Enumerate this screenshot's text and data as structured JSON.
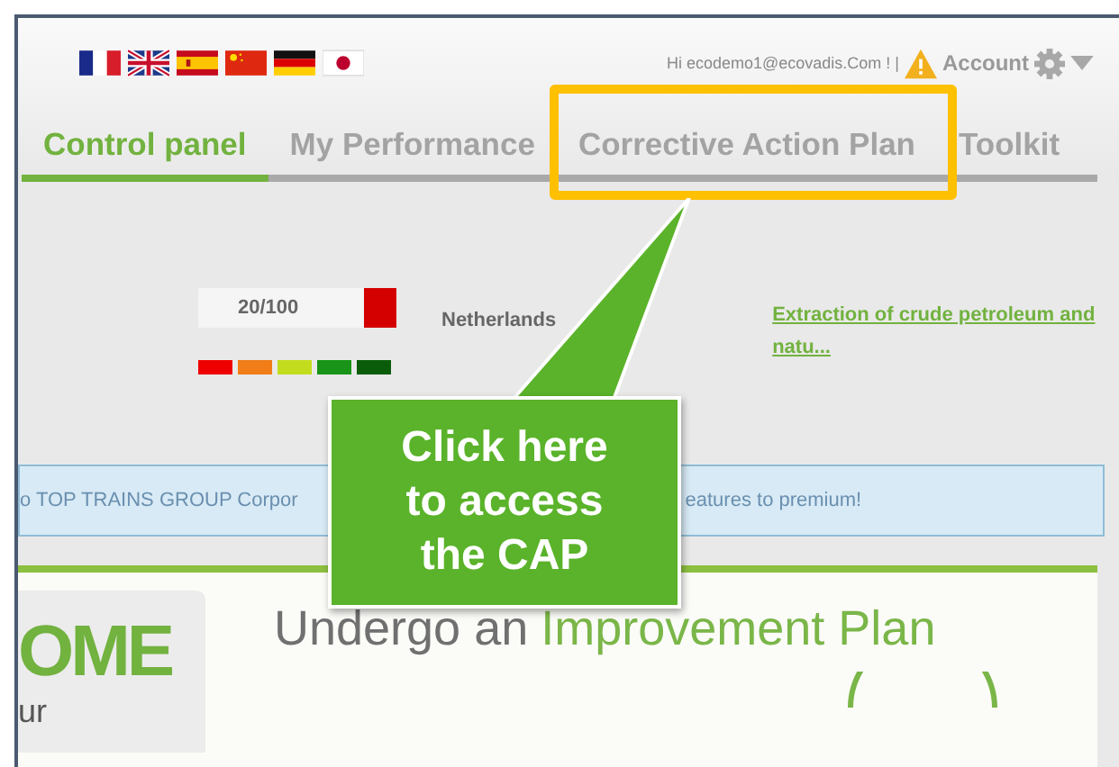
{
  "header": {
    "greeting": "Hi ecodemo1@ecovadis.Com ! |",
    "account": "Account"
  },
  "tabs": [
    {
      "label": "Control panel",
      "selected": true
    },
    {
      "label": "My Performance",
      "selected": false
    },
    {
      "label": "Corrective Action Plan",
      "selected": false
    },
    {
      "label": "Toolkit",
      "selected": false
    }
  ],
  "score": {
    "value": "20/100",
    "color": "#d40000"
  },
  "country": "Netherlands",
  "sector_link": "Extraction of crude petroleum and natu...",
  "banner": {
    "text_left": "o TOP TRAINS GROUP Corpor",
    "text_right": "eatures to premium!"
  },
  "welcome": {
    "title": "OME",
    "subtitle": "ur"
  },
  "heading": {
    "prefix": "Undergo an",
    "highlight": "Improvement Plan"
  },
  "callout": {
    "text": "Click here to access the CAP"
  }
}
